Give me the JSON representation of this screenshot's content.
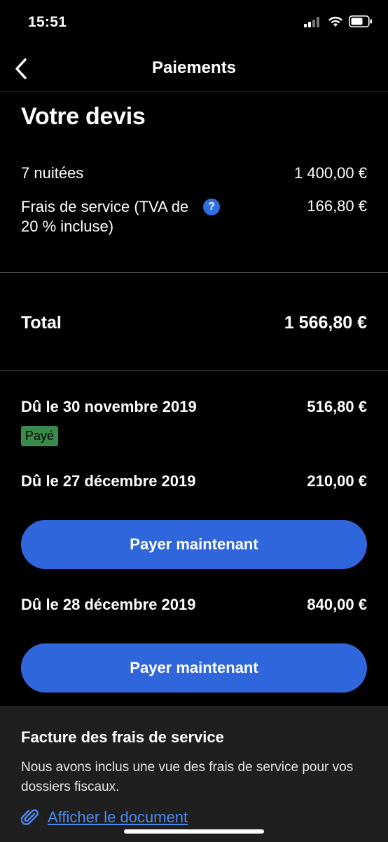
{
  "status_bar": {
    "time": "15:51",
    "icons": [
      "signal-icon",
      "wifi-icon",
      "battery-icon"
    ]
  },
  "nav": {
    "title": "Paiements",
    "back_icon": "chevron-left-icon"
  },
  "quote": {
    "title": "Votre devis",
    "nights": {
      "label": "7 nuitées",
      "amount": "1 400,00 €"
    },
    "fees": {
      "label": "Frais de service (TVA de 20 % incluse)",
      "amount": "166,80 €",
      "help_icon": "?"
    },
    "total": {
      "label": "Total",
      "amount": "1 566,80 €"
    }
  },
  "payments": [
    {
      "label": "Dû le 30 novembre 2019",
      "amount": "516,80 €",
      "status": "Payé"
    },
    {
      "label": "Dû le 27 décembre 2019",
      "amount": "210,00 €",
      "button": "Payer maintenant"
    },
    {
      "label": "Dû le 28 décembre 2019",
      "amount": "840,00 €",
      "button": "Payer maintenant"
    }
  ],
  "invoice": {
    "title": "Facture des frais de service",
    "description": "Nous avons inclus une vue des frais de service pour vos dossiers fiscaux.",
    "link": "Afficher le document",
    "link_icon": "paperclip-icon"
  },
  "colors": {
    "accent": "#2f66dc",
    "link": "#4d8af0",
    "paid_badge": "#3a8a4d",
    "panel": "#1f1f1f"
  }
}
